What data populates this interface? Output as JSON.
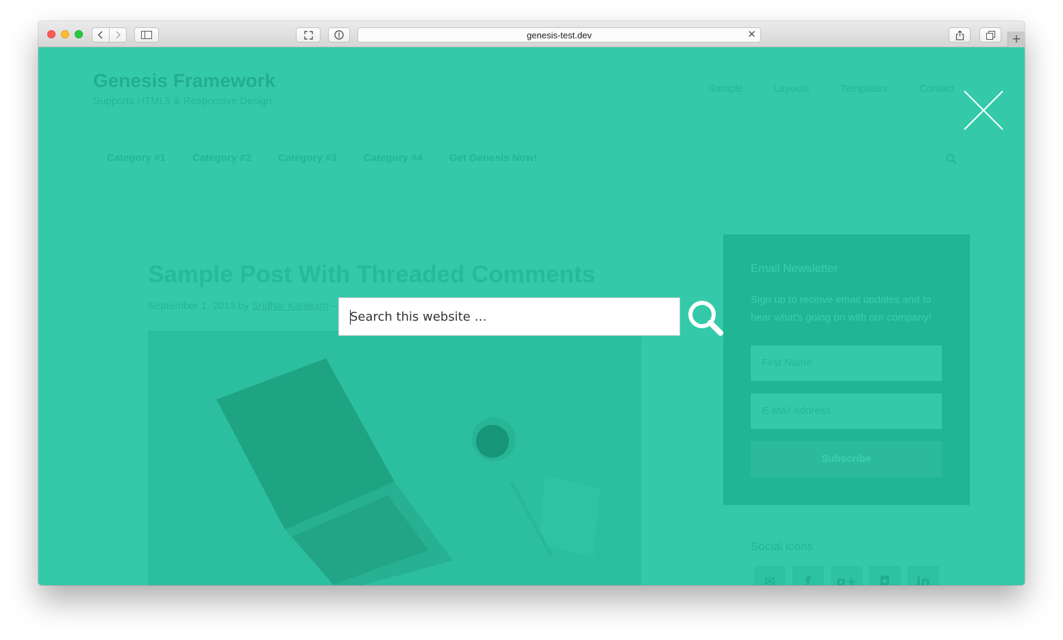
{
  "browser": {
    "url": "genesis-test.dev",
    "new_tab_label": "+"
  },
  "site": {
    "title": "Genesis Framework",
    "description": "Supports HTML5 & Responsive Design",
    "nav": [
      "Sample",
      "Layouts",
      "Templates",
      "Contact"
    ],
    "categories": [
      "Category #1",
      "Category #2",
      "Category #3",
      "Category #4",
      "Get Genesis Now!"
    ]
  },
  "post": {
    "title": "Sample Post With Threaded Comments",
    "date": "September 1, 2013",
    "by": "by",
    "author": "Sridhar Katakam",
    "dash": "—"
  },
  "sidebar": {
    "newsletter_title": "Email Newsletter",
    "newsletter_text": "Sign up to receive email updates and to hear what's going on with our company!",
    "first_name_placeholder": "First Name",
    "email_placeholder": "E-Mail Address",
    "subscribe_label": "Subscribe",
    "social_title": "Social icons",
    "social_icons": [
      "mail-icon",
      "facebook-icon",
      "google-plus-icon",
      "instagram-icon",
      "linkedin-icon"
    ],
    "social_glyphs": [
      "✉",
      "f",
      "g+",
      "◘",
      "in"
    ]
  },
  "search_overlay": {
    "placeholder": "Search this website …",
    "value": ""
  },
  "colors": {
    "overlay": "#34caa9",
    "accent_dark": "#20b593",
    "white": "#ffffff"
  }
}
